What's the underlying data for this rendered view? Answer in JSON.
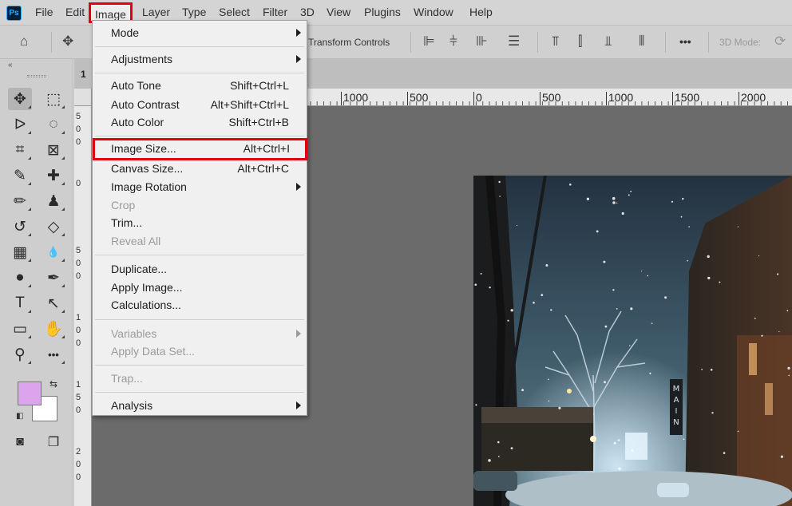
{
  "app": {
    "logo": "Ps"
  },
  "menubar": {
    "items": [
      {
        "label": "File"
      },
      {
        "label": "Edit"
      },
      {
        "label": "Image"
      },
      {
        "label": "Layer"
      },
      {
        "label": "Type"
      },
      {
        "label": "Select"
      },
      {
        "label": "Filter"
      },
      {
        "label": "3D"
      },
      {
        "label": "View"
      },
      {
        "label": "Plugins"
      },
      {
        "label": "Window"
      },
      {
        "label": "Help"
      }
    ],
    "active_item": "Image"
  },
  "options_bar": {
    "transform_controls_label": "Transform Controls",
    "mode_3d_label": "3D Mode:",
    "more_label": "•••"
  },
  "document": {
    "tab_label": "1"
  },
  "ruler": {
    "top_labels": [
      "1000",
      "500",
      "0",
      "500",
      "1000",
      "1500",
      "2000"
    ],
    "left_labels": [
      "5",
      "0",
      "0",
      "0",
      "5",
      "0",
      "0",
      "1",
      "0",
      "0",
      "1",
      "5",
      "0",
      "2",
      "0",
      "0"
    ]
  },
  "image_menu": {
    "items": [
      {
        "label": "Mode",
        "shortcut": "",
        "submenu": true,
        "disabled": false
      },
      {
        "label": "Adjustments",
        "shortcut": "",
        "submenu": true,
        "disabled": false
      },
      {
        "label": "Auto Tone",
        "shortcut": "Shift+Ctrl+L",
        "submenu": false,
        "disabled": false
      },
      {
        "label": "Auto Contrast",
        "shortcut": "Alt+Shift+Ctrl+L",
        "submenu": false,
        "disabled": false
      },
      {
        "label": "Auto Color",
        "shortcut": "Shift+Ctrl+B",
        "submenu": false,
        "disabled": false
      },
      {
        "label": "Image Size...",
        "shortcut": "Alt+Ctrl+I",
        "submenu": false,
        "disabled": false,
        "highlighted": true
      },
      {
        "label": "Canvas Size...",
        "shortcut": "Alt+Ctrl+C",
        "submenu": false,
        "disabled": false
      },
      {
        "label": "Image Rotation",
        "shortcut": "",
        "submenu": true,
        "disabled": false
      },
      {
        "label": "Crop",
        "shortcut": "",
        "submenu": false,
        "disabled": true
      },
      {
        "label": "Trim...",
        "shortcut": "",
        "submenu": false,
        "disabled": false
      },
      {
        "label": "Reveal All",
        "shortcut": "",
        "submenu": false,
        "disabled": true
      },
      {
        "label": "Duplicate...",
        "shortcut": "",
        "submenu": false,
        "disabled": false
      },
      {
        "label": "Apply Image...",
        "shortcut": "",
        "submenu": false,
        "disabled": false
      },
      {
        "label": "Calculations...",
        "shortcut": "",
        "submenu": false,
        "disabled": false
      },
      {
        "label": "Variables",
        "shortcut": "",
        "submenu": true,
        "disabled": true
      },
      {
        "label": "Apply Data Set...",
        "shortcut": "",
        "submenu": false,
        "disabled": true
      },
      {
        "label": "Trap...",
        "shortcut": "",
        "submenu": false,
        "disabled": true
      },
      {
        "label": "Analysis",
        "shortcut": "",
        "submenu": true,
        "disabled": false
      }
    ]
  },
  "tools": [
    {
      "name": "move-tool",
      "icon": "✥"
    },
    {
      "name": "rectangular-marquee-tool",
      "icon": "⬚"
    },
    {
      "name": "lasso-tool",
      "icon": "ᐅ"
    },
    {
      "name": "quick-selection-tool",
      "icon": "◌"
    },
    {
      "name": "crop-tool",
      "icon": "⌗"
    },
    {
      "name": "frame-tool",
      "icon": "⊠"
    },
    {
      "name": "eyedropper-tool",
      "icon": "✎"
    },
    {
      "name": "healing-brush-tool",
      "icon": "✚"
    },
    {
      "name": "brush-tool",
      "icon": "✏"
    },
    {
      "name": "clone-stamp-tool",
      "icon": "♟"
    },
    {
      "name": "history-brush-tool",
      "icon": "↺"
    },
    {
      "name": "eraser-tool",
      "icon": "◇"
    },
    {
      "name": "gradient-tool",
      "icon": "▦"
    },
    {
      "name": "blur-tool",
      "icon": "💧"
    },
    {
      "name": "dodge-tool",
      "icon": "●"
    },
    {
      "name": "pen-tool",
      "icon": "✒"
    },
    {
      "name": "type-tool",
      "icon": "T"
    },
    {
      "name": "path-selection-tool",
      "icon": "↖"
    },
    {
      "name": "rectangle-tool",
      "icon": "▭"
    },
    {
      "name": "hand-tool",
      "icon": "✋"
    },
    {
      "name": "zoom-tool",
      "icon": "⚲"
    },
    {
      "name": "more-tools",
      "icon": "•••"
    }
  ],
  "colors": {
    "foreground": "#dba4ec",
    "background": "#ffffff",
    "highlight_border": "#e1000f"
  }
}
